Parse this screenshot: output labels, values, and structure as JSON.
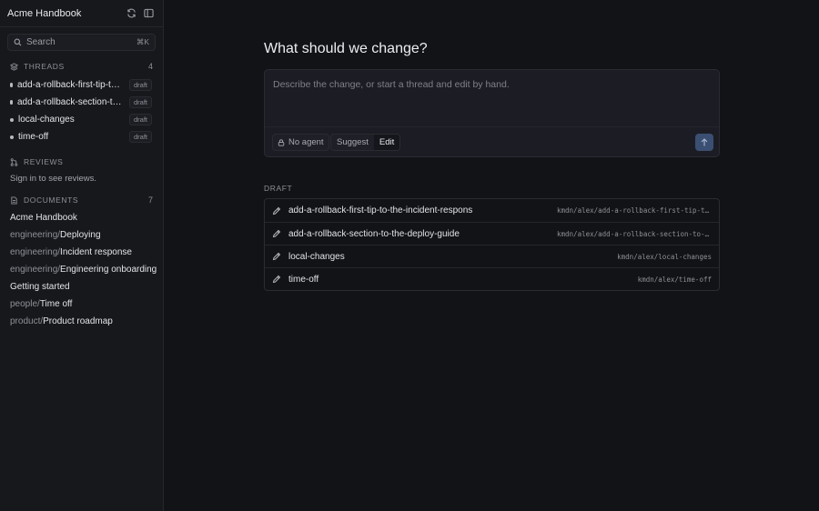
{
  "sidebar": {
    "title": "Acme Handbook",
    "search": {
      "label": "Search",
      "shortcut": "⌘K"
    },
    "threads": {
      "label": "THREADS",
      "count": "4",
      "items": [
        {
          "label": "add-a-rollback-first-tip-to-the-incident-response",
          "badge": "draft"
        },
        {
          "label": "add-a-rollback-section-to-the-deploy-guide",
          "badge": "draft"
        },
        {
          "label": "local-changes",
          "badge": "draft"
        },
        {
          "label": "time-off",
          "badge": "draft"
        }
      ]
    },
    "reviews": {
      "label": "REVIEWS",
      "message": "Sign in to see reviews."
    },
    "documents": {
      "label": "DOCUMENTS",
      "count": "7",
      "items": [
        {
          "prefix": "",
          "name": "Acme Handbook"
        },
        {
          "prefix": "engineering/",
          "name": "Deploying"
        },
        {
          "prefix": "engineering/",
          "name": "Incident response"
        },
        {
          "prefix": "engineering/",
          "name": "Engineering onboarding"
        },
        {
          "prefix": "",
          "name": "Getting started"
        },
        {
          "prefix": "people/",
          "name": "Time off"
        },
        {
          "prefix": "product/",
          "name": "Product roadmap"
        }
      ]
    }
  },
  "main": {
    "heading": "What should we change?",
    "composer": {
      "placeholder": "Describe the change, or start a thread and edit by hand.",
      "agent_label": "No agent",
      "mode_suggest": "Suggest",
      "mode_edit": "Edit",
      "active_mode": "Edit"
    },
    "draft": {
      "label": "DRAFT",
      "rows": [
        {
          "name": "add-a-rollback-first-tip-to-the-incident-respons",
          "ref": "kmdn/alex/add-a-rollback-first-tip-to-…"
        },
        {
          "name": "add-a-rollback-section-to-the-deploy-guide",
          "ref": "kmdn/alex/add-a-rollback-section-to-th…"
        },
        {
          "name": "local-changes",
          "ref": "kmdn/alex/local-changes"
        },
        {
          "name": "time-off",
          "ref": "kmdn/alex/time-off"
        }
      ]
    }
  },
  "colors": {
    "background": "#121316",
    "sidebar": "#17181c",
    "accent": "#3b4f73"
  },
  "icons": [
    "refresh-icon",
    "sidebar-toggle-icon",
    "search-icon",
    "layers-icon",
    "pull-request-icon",
    "document-icon",
    "lock-icon",
    "arrow-up-icon",
    "pencil-icon"
  ]
}
